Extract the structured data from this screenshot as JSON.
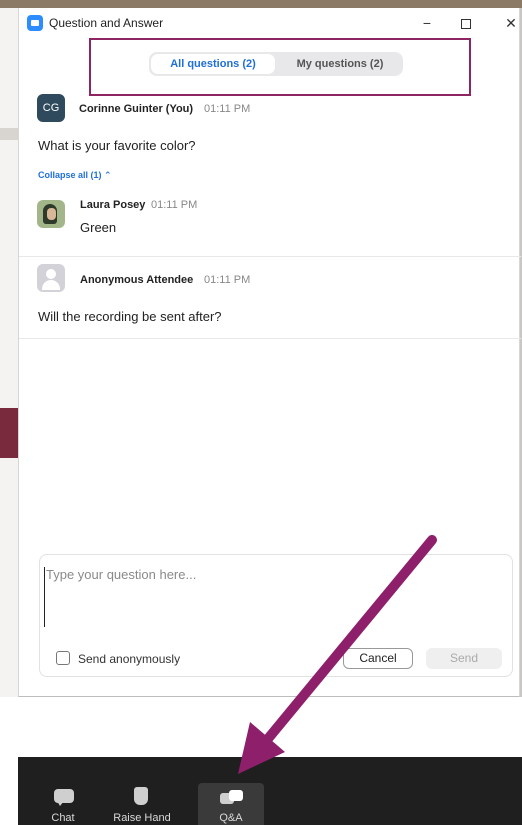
{
  "window": {
    "title": "Question and Answer",
    "minimize": "−",
    "close": "✕"
  },
  "tabs": {
    "all": "All questions (2)",
    "mine": "My questions (2)"
  },
  "messages": [
    {
      "avatar": "CG",
      "name": "Corinne Guinter (You)",
      "time": "01:11 PM",
      "text": "What is your favorite color?",
      "collapse": "Collapse all (1) ⌃",
      "reply": {
        "name": "Laura Posey",
        "time": "01:11 PM",
        "text": "Green"
      }
    },
    {
      "name": "Anonymous Attendee",
      "time": "01:11 PM",
      "text": "Will the recording be sent after?"
    }
  ],
  "compose": {
    "placeholder": "Type your question here...",
    "anonymous_label": "Send anonymously",
    "cancel": "Cancel",
    "send": "Send"
  },
  "toolbar": {
    "chat": "Chat",
    "raise_hand": "Raise Hand",
    "qa": "Q&A"
  },
  "colors": {
    "accent": "#1f6fd6",
    "highlight": "#8e2462",
    "toolbar_bg": "#1f1f1f"
  }
}
